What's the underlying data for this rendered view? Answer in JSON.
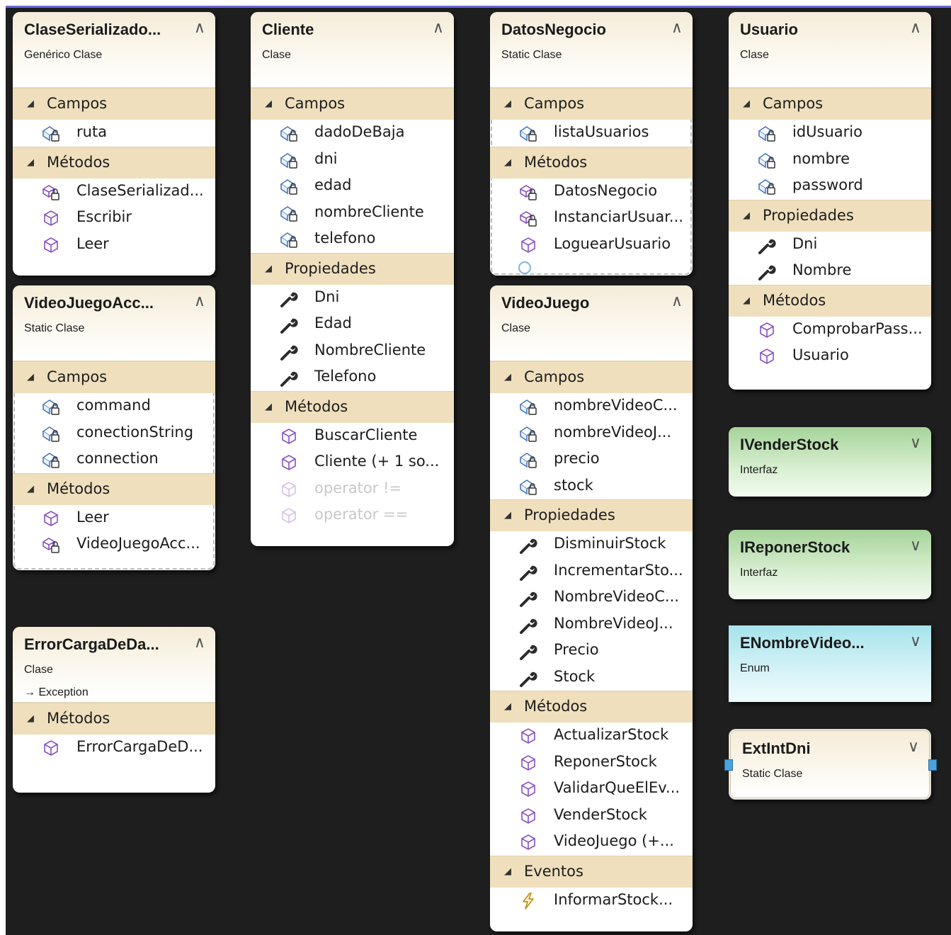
{
  "sections_labels": {
    "fields": "Campos",
    "methods": "Métodos",
    "properties": "Propiedades",
    "events": "Eventos"
  },
  "shapes": [
    {
      "id": "ClaseSerializado",
      "title": "ClaseSerializado...",
      "stereotype": "Genérico Clase",
      "collapsed": false,
      "sections": [
        {
          "label": "Campos",
          "members": [
            {
              "name": "ruta",
              "kind": "field"
            }
          ]
        },
        {
          "label": "Métodos",
          "members": [
            {
              "name": "ClaseSerializad...",
              "kind": "method-private"
            },
            {
              "name": "Escribir",
              "kind": "method"
            },
            {
              "name": "Leer",
              "kind": "method"
            }
          ]
        }
      ]
    },
    {
      "id": "Cliente",
      "title": "Cliente",
      "stereotype": "Clase",
      "collapsed": false,
      "sections": [
        {
          "label": "Campos",
          "members": [
            {
              "name": "dadoDeBaja",
              "kind": "field"
            },
            {
              "name": "dni",
              "kind": "field"
            },
            {
              "name": "edad",
              "kind": "field"
            },
            {
              "name": "nombreCliente",
              "kind": "field"
            },
            {
              "name": "telefono",
              "kind": "field"
            }
          ]
        },
        {
          "label": "Propiedades",
          "members": [
            {
              "name": "Dni",
              "kind": "property"
            },
            {
              "name": "Edad",
              "kind": "property"
            },
            {
              "name": "NombreCliente",
              "kind": "property"
            },
            {
              "name": "Telefono",
              "kind": "property"
            }
          ]
        },
        {
          "label": "Métodos",
          "members": [
            {
              "name": "BuscarCliente",
              "kind": "method"
            },
            {
              "name": "Cliente (+ 1 so...",
              "kind": "method"
            },
            {
              "name": "operator !=",
              "kind": "method",
              "dim": true
            },
            {
              "name": "operator ==",
              "kind": "method",
              "dim": true
            }
          ]
        }
      ]
    },
    {
      "id": "DatosNegocio",
      "title": "DatosNegocio",
      "stereotype": "Static Clase",
      "collapsed": false,
      "sections": [
        {
          "label": "Campos",
          "members": [
            {
              "name": "listaUsuarios",
              "kind": "field"
            }
          ]
        },
        {
          "label": "Métodos",
          "members": [
            {
              "name": "DatosNegocio",
              "kind": "method-private"
            },
            {
              "name": "InstanciarUsuar...",
              "kind": "method-private"
            },
            {
              "name": "LoguearUsuario",
              "kind": "method"
            }
          ]
        }
      ]
    },
    {
      "id": "Usuario",
      "title": "Usuario",
      "stereotype": "Clase",
      "collapsed": false,
      "sections": [
        {
          "label": "Campos",
          "members": [
            {
              "name": "idUsuario",
              "kind": "field"
            },
            {
              "name": "nombre",
              "kind": "field"
            },
            {
              "name": "password",
              "kind": "field"
            }
          ]
        },
        {
          "label": "Propiedades",
          "members": [
            {
              "name": "Dni",
              "kind": "property"
            },
            {
              "name": "Nombre",
              "kind": "property"
            }
          ]
        },
        {
          "label": "Métodos",
          "members": [
            {
              "name": "ComprobarPass...",
              "kind": "method"
            },
            {
              "name": "Usuario",
              "kind": "method"
            }
          ]
        }
      ]
    },
    {
      "id": "VideoJuegoAcc",
      "title": "VideoJuegoAcc...",
      "stereotype": "Static Clase",
      "collapsed": false,
      "sections": [
        {
          "label": "Campos",
          "members": [
            {
              "name": "command",
              "kind": "field"
            },
            {
              "name": "conectionString",
              "kind": "field"
            },
            {
              "name": "connection",
              "kind": "field"
            }
          ]
        },
        {
          "label": "Métodos",
          "members": [
            {
              "name": "Leer",
              "kind": "method"
            },
            {
              "name": "VideoJuegoAcc...",
              "kind": "method-private"
            }
          ]
        }
      ]
    },
    {
      "id": "VideoJuego",
      "title": "VideoJuego",
      "stereotype": "Clase",
      "collapsed": false,
      "sections": [
        {
          "label": "Campos",
          "members": [
            {
              "name": "nombreVideoC...",
              "kind": "field"
            },
            {
              "name": "nombreVideoJ...",
              "kind": "field"
            },
            {
              "name": "precio",
              "kind": "field"
            },
            {
              "name": "stock",
              "kind": "field"
            }
          ]
        },
        {
          "label": "Propiedades",
          "members": [
            {
              "name": "DisminuirStock",
              "kind": "property"
            },
            {
              "name": "IncrementarSto...",
              "kind": "property"
            },
            {
              "name": "NombreVideoC...",
              "kind": "property"
            },
            {
              "name": "NombreVideoJ...",
              "kind": "property"
            },
            {
              "name": "Precio",
              "kind": "property"
            },
            {
              "name": "Stock",
              "kind": "property"
            }
          ]
        },
        {
          "label": "Métodos",
          "members": [
            {
              "name": "ActualizarStock",
              "kind": "method"
            },
            {
              "name": "ReponerStock",
              "kind": "method"
            },
            {
              "name": "ValidarQueElEv...",
              "kind": "method"
            },
            {
              "name": "VenderStock",
              "kind": "method"
            },
            {
              "name": "VideoJuego (+...",
              "kind": "method"
            }
          ]
        },
        {
          "label": "Eventos",
          "members": [
            {
              "name": "InformarStock...",
              "kind": "event"
            }
          ]
        }
      ]
    },
    {
      "id": "ErrorCargaDeDa",
      "title": "ErrorCargaDeDa...",
      "stereotype": "Clase",
      "base": "Exception",
      "collapsed": false,
      "sections": [
        {
          "label": "Métodos",
          "members": [
            {
              "name": "ErrorCargaDeD...",
              "kind": "method"
            }
          ]
        }
      ]
    },
    {
      "id": "IVenderStock",
      "title": "IVenderStock",
      "stereotype": "Interfaz",
      "collapsed": true,
      "sections": []
    },
    {
      "id": "IReponerStock",
      "title": "IReponerStock",
      "stereotype": "Interfaz",
      "collapsed": true,
      "sections": []
    },
    {
      "id": "ENombreVideo",
      "title": "ENombreVideo...",
      "stereotype": "Enum",
      "collapsed": true,
      "sections": []
    },
    {
      "id": "ExtIntDni",
      "title": "ExtIntDni",
      "stereotype": "Static Clase",
      "collapsed": true,
      "sections": []
    }
  ]
}
